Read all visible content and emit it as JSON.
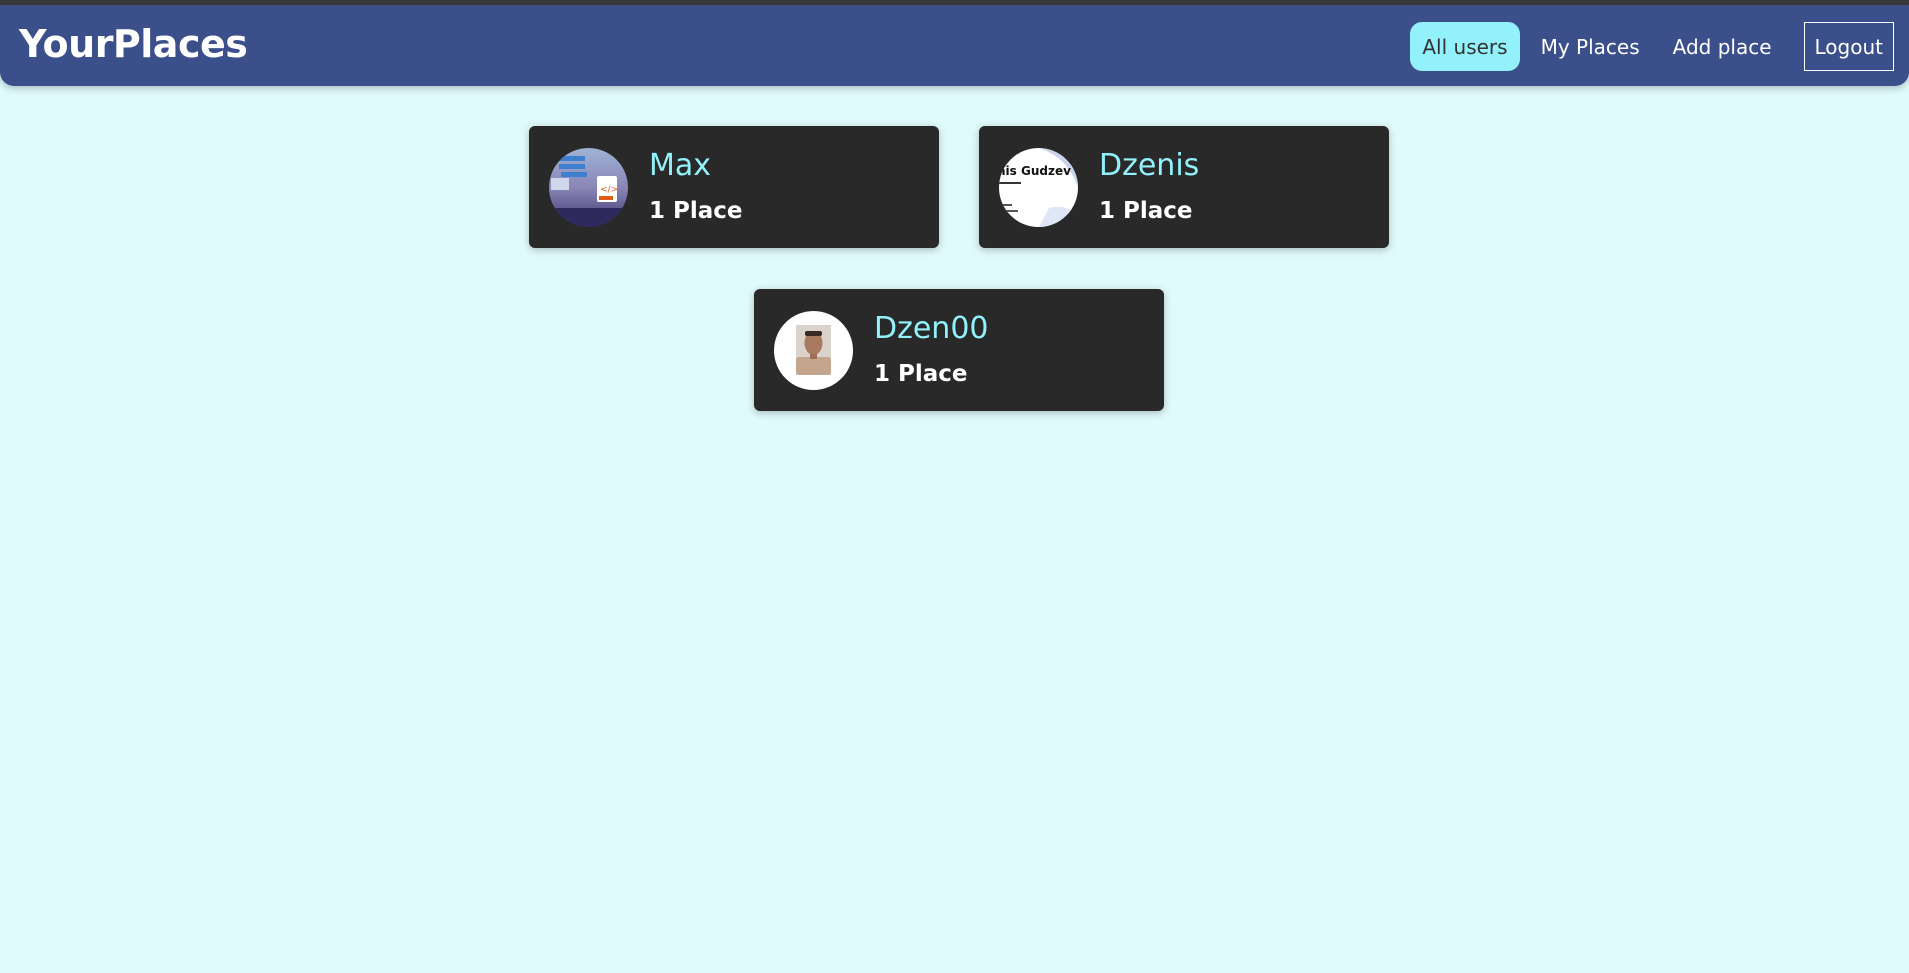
{
  "header": {
    "brand": "YourPlaces",
    "nav": {
      "all_users": "All users",
      "my_places": "My Places",
      "add_place": "Add place",
      "logout": "Logout"
    },
    "colors": {
      "header_bg": "#3b4f8a",
      "active_bg": "#92f1fa"
    }
  },
  "users": [
    {
      "name": "Max",
      "places": "1 Place"
    },
    {
      "name": "Dzenis",
      "places": "1 Place",
      "avatar_text": "nis Gudzev"
    },
    {
      "name": "Dzen00",
      "places": "1 Place"
    }
  ],
  "colors": {
    "page_bg": "#e0fbfc",
    "card_bg": "#292929",
    "user_name": "#92f1fa"
  }
}
